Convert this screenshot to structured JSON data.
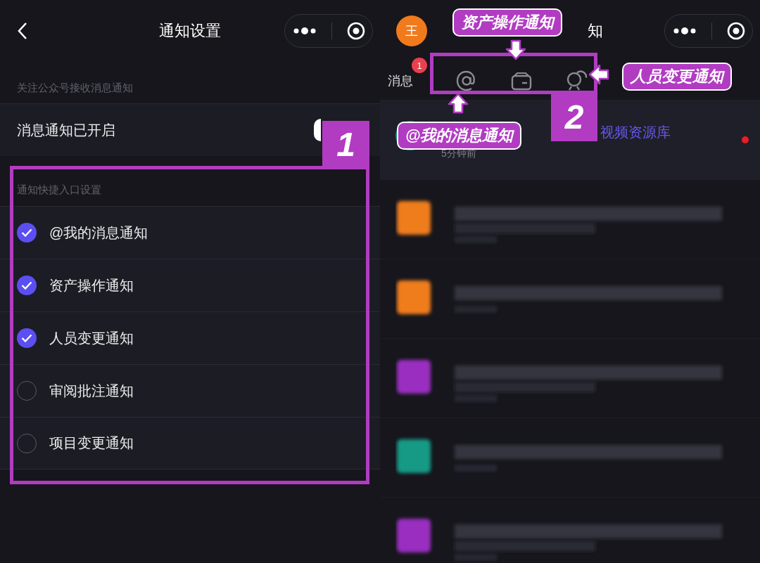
{
  "settings_screen": {
    "title": "通知设置",
    "follow_section": "关注公众号接收消息通知",
    "notification_row": {
      "label": "消息通知已开启",
      "on": true
    },
    "shortcut_section": "通知快捷入口设置",
    "shortcuts": [
      {
        "label": "@我的消息通知",
        "checked": true
      },
      {
        "label": "资产操作通知",
        "checked": true
      },
      {
        "label": "人员变更通知",
        "checked": true
      },
      {
        "label": "审阅批注通知",
        "checked": false
      },
      {
        "label": "项目变更通知",
        "checked": false
      }
    ]
  },
  "message_screen": {
    "avatar": "王",
    "title_visible": "知",
    "tab": {
      "label": "消息",
      "badge": "1"
    },
    "shortcut_icons": [
      {
        "kind": "at"
      },
      {
        "kind": "wallet"
      },
      {
        "kind": "people"
      }
    ],
    "first_message": {
      "title": "视频资源库",
      "time": "5分钟前",
      "unread": true
    },
    "blurred_rows": [
      {
        "color": "#f07d1e"
      },
      {
        "color": "#f07d1e"
      },
      {
        "color": "#9a2fc0"
      },
      {
        "color": "#159a86"
      },
      {
        "color": "#9a2fc0"
      }
    ]
  },
  "annotations": {
    "box_numbers": [
      "1",
      "2"
    ],
    "callouts": [
      {
        "text": "资产操作通知"
      },
      {
        "text": "人员变更通知"
      },
      {
        "text": "@我的消息通知"
      }
    ]
  }
}
